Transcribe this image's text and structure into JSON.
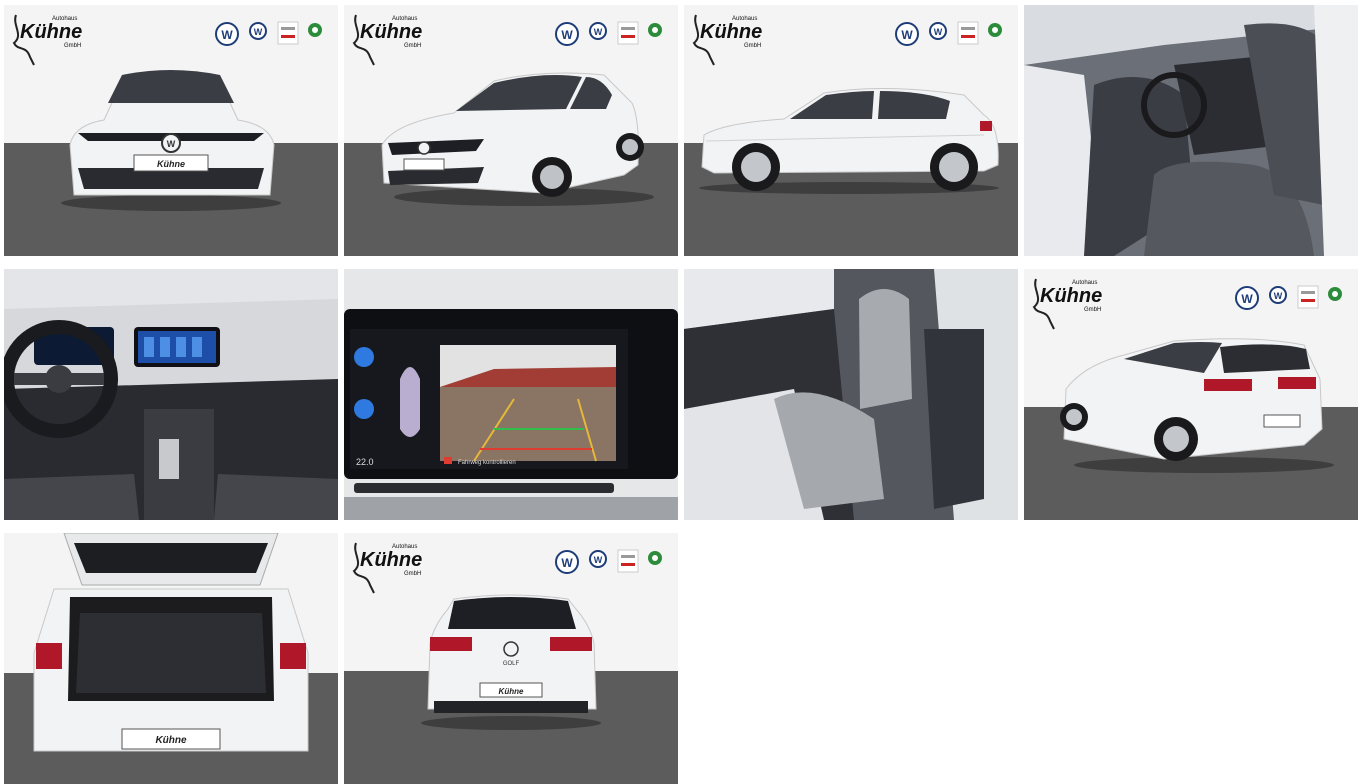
{
  "gallery": {
    "dealer": {
      "name": "Kühne",
      "prefix": "Autohaus",
      "suffix": "GmbH",
      "brand_badges": [
        "Volkswagen",
        "VW Nutzfahrzeuge",
        "Audi Service",
        "Skoda Service"
      ]
    },
    "plate_text": "Kühne",
    "infotainment": {
      "temperature": "22.0",
      "warning": "Fahrweg kontrollieren"
    },
    "rear_badge": "GOLF",
    "tiles": [
      {
        "id": 1,
        "view": "front"
      },
      {
        "id": 2,
        "view": "front-three-quarter"
      },
      {
        "id": 3,
        "view": "side"
      },
      {
        "id": 4,
        "view": "front-seats-interior"
      },
      {
        "id": 5,
        "view": "dashboard"
      },
      {
        "id": 6,
        "view": "rear-camera-display"
      },
      {
        "id": 7,
        "view": "rear-seats-interior"
      },
      {
        "id": 8,
        "view": "rear-three-quarter"
      },
      {
        "id": 9,
        "view": "open-trunk"
      },
      {
        "id": 10,
        "view": "rear"
      }
    ],
    "colors": {
      "car": "#f2f3f5",
      "floor": "#5c5c5d",
      "wall": "#f4f4f4",
      "vw_blue": "#1e3c78",
      "taillight": "#b0182a"
    }
  }
}
